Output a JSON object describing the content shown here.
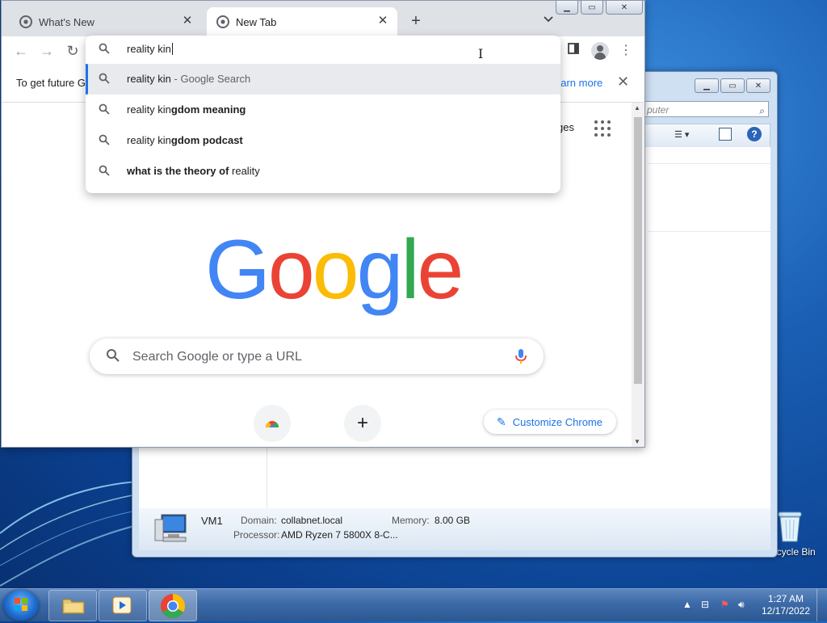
{
  "chrome": {
    "tabs": [
      {
        "title": "What's New",
        "active": false
      },
      {
        "title": "New Tab",
        "active": true
      }
    ],
    "omnibox": {
      "value": "reality kin",
      "suggestions": [
        {
          "typed": "reality kin",
          "rest": "",
          "desc": " - Google Search"
        },
        {
          "typed": "reality kin",
          "rest": "gdom meaning",
          "desc": ""
        },
        {
          "typed": "reality kin",
          "rest": "gdom podcast",
          "desc": ""
        },
        {
          "bold": "what is the theory of",
          "plain": " reality"
        }
      ]
    },
    "infobar": {
      "text": "To get future G",
      "link": "earn more"
    },
    "ntp": {
      "images_link": "ges",
      "logo_letters": [
        "G",
        "o",
        "o",
        "g",
        "l",
        "e"
      ],
      "search_placeholder": "Search Google or type a URL",
      "customize_label": "Customize Chrome"
    }
  },
  "explorer": {
    "search_placeholder": "puter",
    "details": {
      "computer_name": "VM1",
      "domain_label": "Domain:",
      "domain_value": "collabnet.local",
      "memory_label": "Memory:",
      "memory_value": "8.00 GB",
      "processor_label": "Processor:",
      "processor_value": "AMD Ryzen 7 5800X 8-C..."
    }
  },
  "desktop": {
    "recycle_bin_label": "Recycle Bin"
  },
  "taskbar": {
    "time": "1:27 AM",
    "date": "12/17/2022"
  },
  "colors": {
    "google_blue": "#4285F4",
    "google_red": "#EA4335",
    "google_yellow": "#FBBC05",
    "google_green": "#34A853",
    "chrome_accent": "#1a73e8"
  }
}
